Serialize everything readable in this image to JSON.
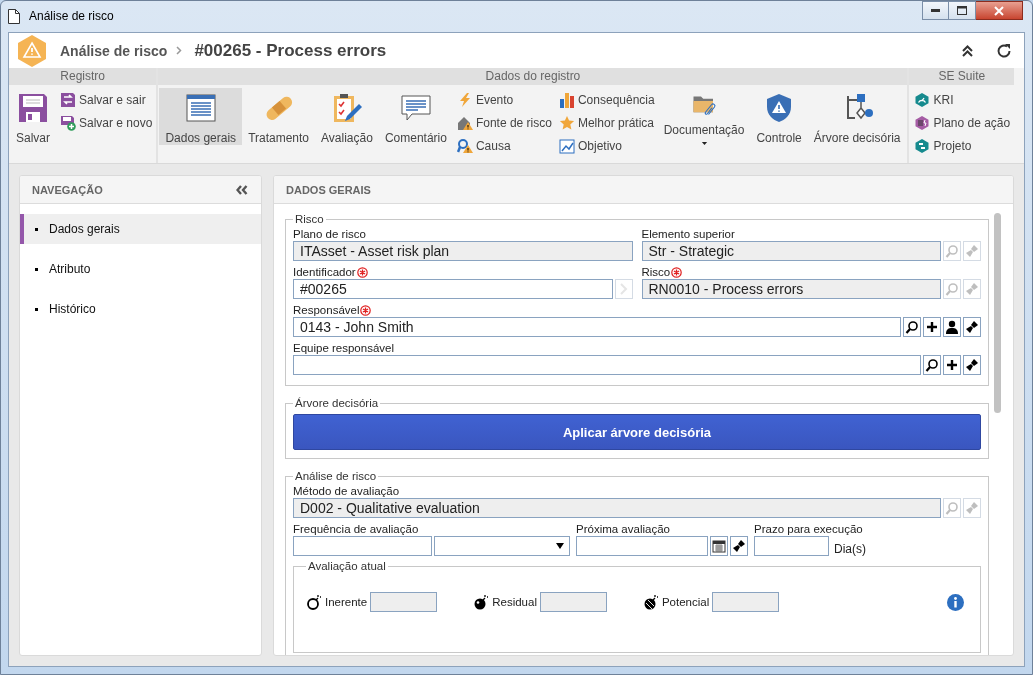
{
  "window": {
    "title": "Análise de risco"
  },
  "header": {
    "breadcrumb": "Análise de risco",
    "title": "#00265 - Process errors"
  },
  "ribbon": {
    "groups": [
      {
        "label": "Registro",
        "columns": [
          {
            "kind": "large",
            "items": [
              {
                "label": "Salvar",
                "selected": false
              }
            ]
          },
          {
            "kind": "stack",
            "items": [
              {
                "label": "Salvar e sair",
                "selected": false
              },
              {
                "label": "Salvar e novo",
                "selected": false
              }
            ]
          }
        ]
      },
      {
        "label": "Dados do registro",
        "columns": [
          {
            "kind": "large",
            "items": [
              {
                "label": "Dados gerais",
                "selected": true
              }
            ]
          },
          {
            "kind": "large",
            "items": [
              {
                "label": "Tratamento",
                "selected": false
              }
            ]
          },
          {
            "kind": "large",
            "items": [
              {
                "label": "Avaliação",
                "selected": false
              }
            ]
          },
          {
            "kind": "large",
            "items": [
              {
                "label": "Comentário",
                "selected": false
              }
            ]
          },
          {
            "kind": "stack",
            "items": [
              {
                "label": "Evento",
                "selected": false
              },
              {
                "label": "Fonte de risco",
                "selected": false
              },
              {
                "label": "Causa",
                "selected": false
              }
            ]
          },
          {
            "kind": "stack",
            "items": [
              {
                "label": "Consequência",
                "selected": false
              },
              {
                "label": "Melhor prática",
                "selected": false
              },
              {
                "label": "Objetivo",
                "selected": false
              }
            ]
          },
          {
            "kind": "large",
            "items": [
              {
                "label": "Documentação",
                "selected": false,
                "dropdown": true
              }
            ]
          },
          {
            "kind": "large",
            "items": [
              {
                "label": "Controle",
                "selected": false
              }
            ]
          },
          {
            "kind": "large",
            "items": [
              {
                "label": "Árvore decisória",
                "selected": false
              }
            ]
          }
        ]
      },
      {
        "label": "SE Suite",
        "columns": [
          {
            "kind": "stack",
            "items": [
              {
                "label": "KRI",
                "selected": false
              },
              {
                "label": "Plano de ação",
                "selected": false
              },
              {
                "label": "Projeto",
                "selected": false
              }
            ]
          }
        ]
      }
    ]
  },
  "navigation": {
    "title": "NAVEGAÇÃO",
    "items": [
      {
        "label": "Dados gerais",
        "selected": true
      },
      {
        "label": "Atributo",
        "selected": false
      },
      {
        "label": "Histórico",
        "selected": false
      }
    ]
  },
  "main": {
    "title": "DADOS GERAIS",
    "sections": [
      {
        "kind": "fields",
        "legend": "Risco",
        "rows": [
          {
            "kind": "half",
            "fields": [
              {
                "kind": "text",
                "label": "Plano de risco",
                "value": "ITAsset - Asset risk plan",
                "required": false,
                "readonly": true
              },
              {
                "kind": "text",
                "label": "Elemento superior",
                "value": "Str - Strategic",
                "required": false,
                "readonly": true,
                "buttons": [
                  {
                    "kind": "search",
                    "disabled": true
                  },
                  {
                    "kind": "clear",
                    "disabled": true
                  }
                ]
              }
            ]
          },
          {
            "kind": "half",
            "fields": [
              {
                "kind": "text",
                "label": "Identificador",
                "value": "#00265",
                "required": true,
                "readonly": false,
                "buttons": [
                  {
                    "kind": "next",
                    "disabled": true
                  }
                ]
              },
              {
                "kind": "text",
                "label": "Risco",
                "value": "RN0010 - Process errors",
                "required": true,
                "readonly": true,
                "buttons": [
                  {
                    "kind": "search",
                    "disabled": true
                  },
                  {
                    "kind": "clear",
                    "disabled": true
                  }
                ]
              }
            ]
          },
          {
            "kind": "full",
            "fields": [
              {
                "kind": "text",
                "label": "Responsável",
                "value": "0143 - John Smith",
                "required": true,
                "readonly": false,
                "buttons": [
                  {
                    "kind": "search",
                    "disabled": false
                  },
                  {
                    "kind": "add",
                    "disabled": false
                  },
                  {
                    "kind": "user",
                    "disabled": false
                  },
                  {
                    "kind": "clear",
                    "disabled": false
                  }
                ]
              }
            ]
          },
          {
            "kind": "full",
            "fields": [
              {
                "kind": "text",
                "label": "Equipe responsável",
                "required": false,
                "readonly": false,
                "buttons": [
                  {
                    "kind": "search",
                    "disabled": false
                  },
                  {
                    "kind": "add",
                    "disabled": false
                  },
                  {
                    "kind": "clear",
                    "disabled": false
                  }
                ]
              }
            ]
          }
        ]
      },
      {
        "kind": "action",
        "legend": "Árvore decisória",
        "action": "Aplicar árvore decisória"
      },
      {
        "kind": "fields",
        "legend": "Análise de risco",
        "rows": [
          {
            "kind": "full",
            "fields": [
              {
                "kind": "text",
                "label": "Método de avaliação",
                "value": "D002 - Qualitative evaluation",
                "required": false,
                "readonly": true,
                "buttons": [
                  {
                    "kind": "search",
                    "disabled": true
                  },
                  {
                    "kind": "clear",
                    "disabled": true
                  }
                ]
              }
            ]
          },
          {
            "kind": "three",
            "fields": [
              {
                "kind": "text_select",
                "label": "Frequência de avaliação",
                "required": false,
                "readonly": false
              },
              {
                "kind": "text",
                "label": "Próxima avaliação",
                "required": false,
                "readonly": false,
                "buttons": [
                  {
                    "kind": "calendar",
                    "disabled": false
                  },
                  {
                    "kind": "clear",
                    "disabled": false
                  }
                ]
              },
              {
                "kind": "text",
                "label": "Prazo para execução",
                "suffix": "Dia(s)",
                "required": false,
                "readonly": false
              }
            ]
          }
        ],
        "subsection": {
          "legend": "Avaliação atual",
          "ratings": [
            {
              "label": "Inerente",
              "readonly": true
            },
            {
              "label": "Residual",
              "readonly": true
            },
            {
              "label": "Potencial",
              "readonly": true
            }
          ]
        }
      }
    ]
  }
}
